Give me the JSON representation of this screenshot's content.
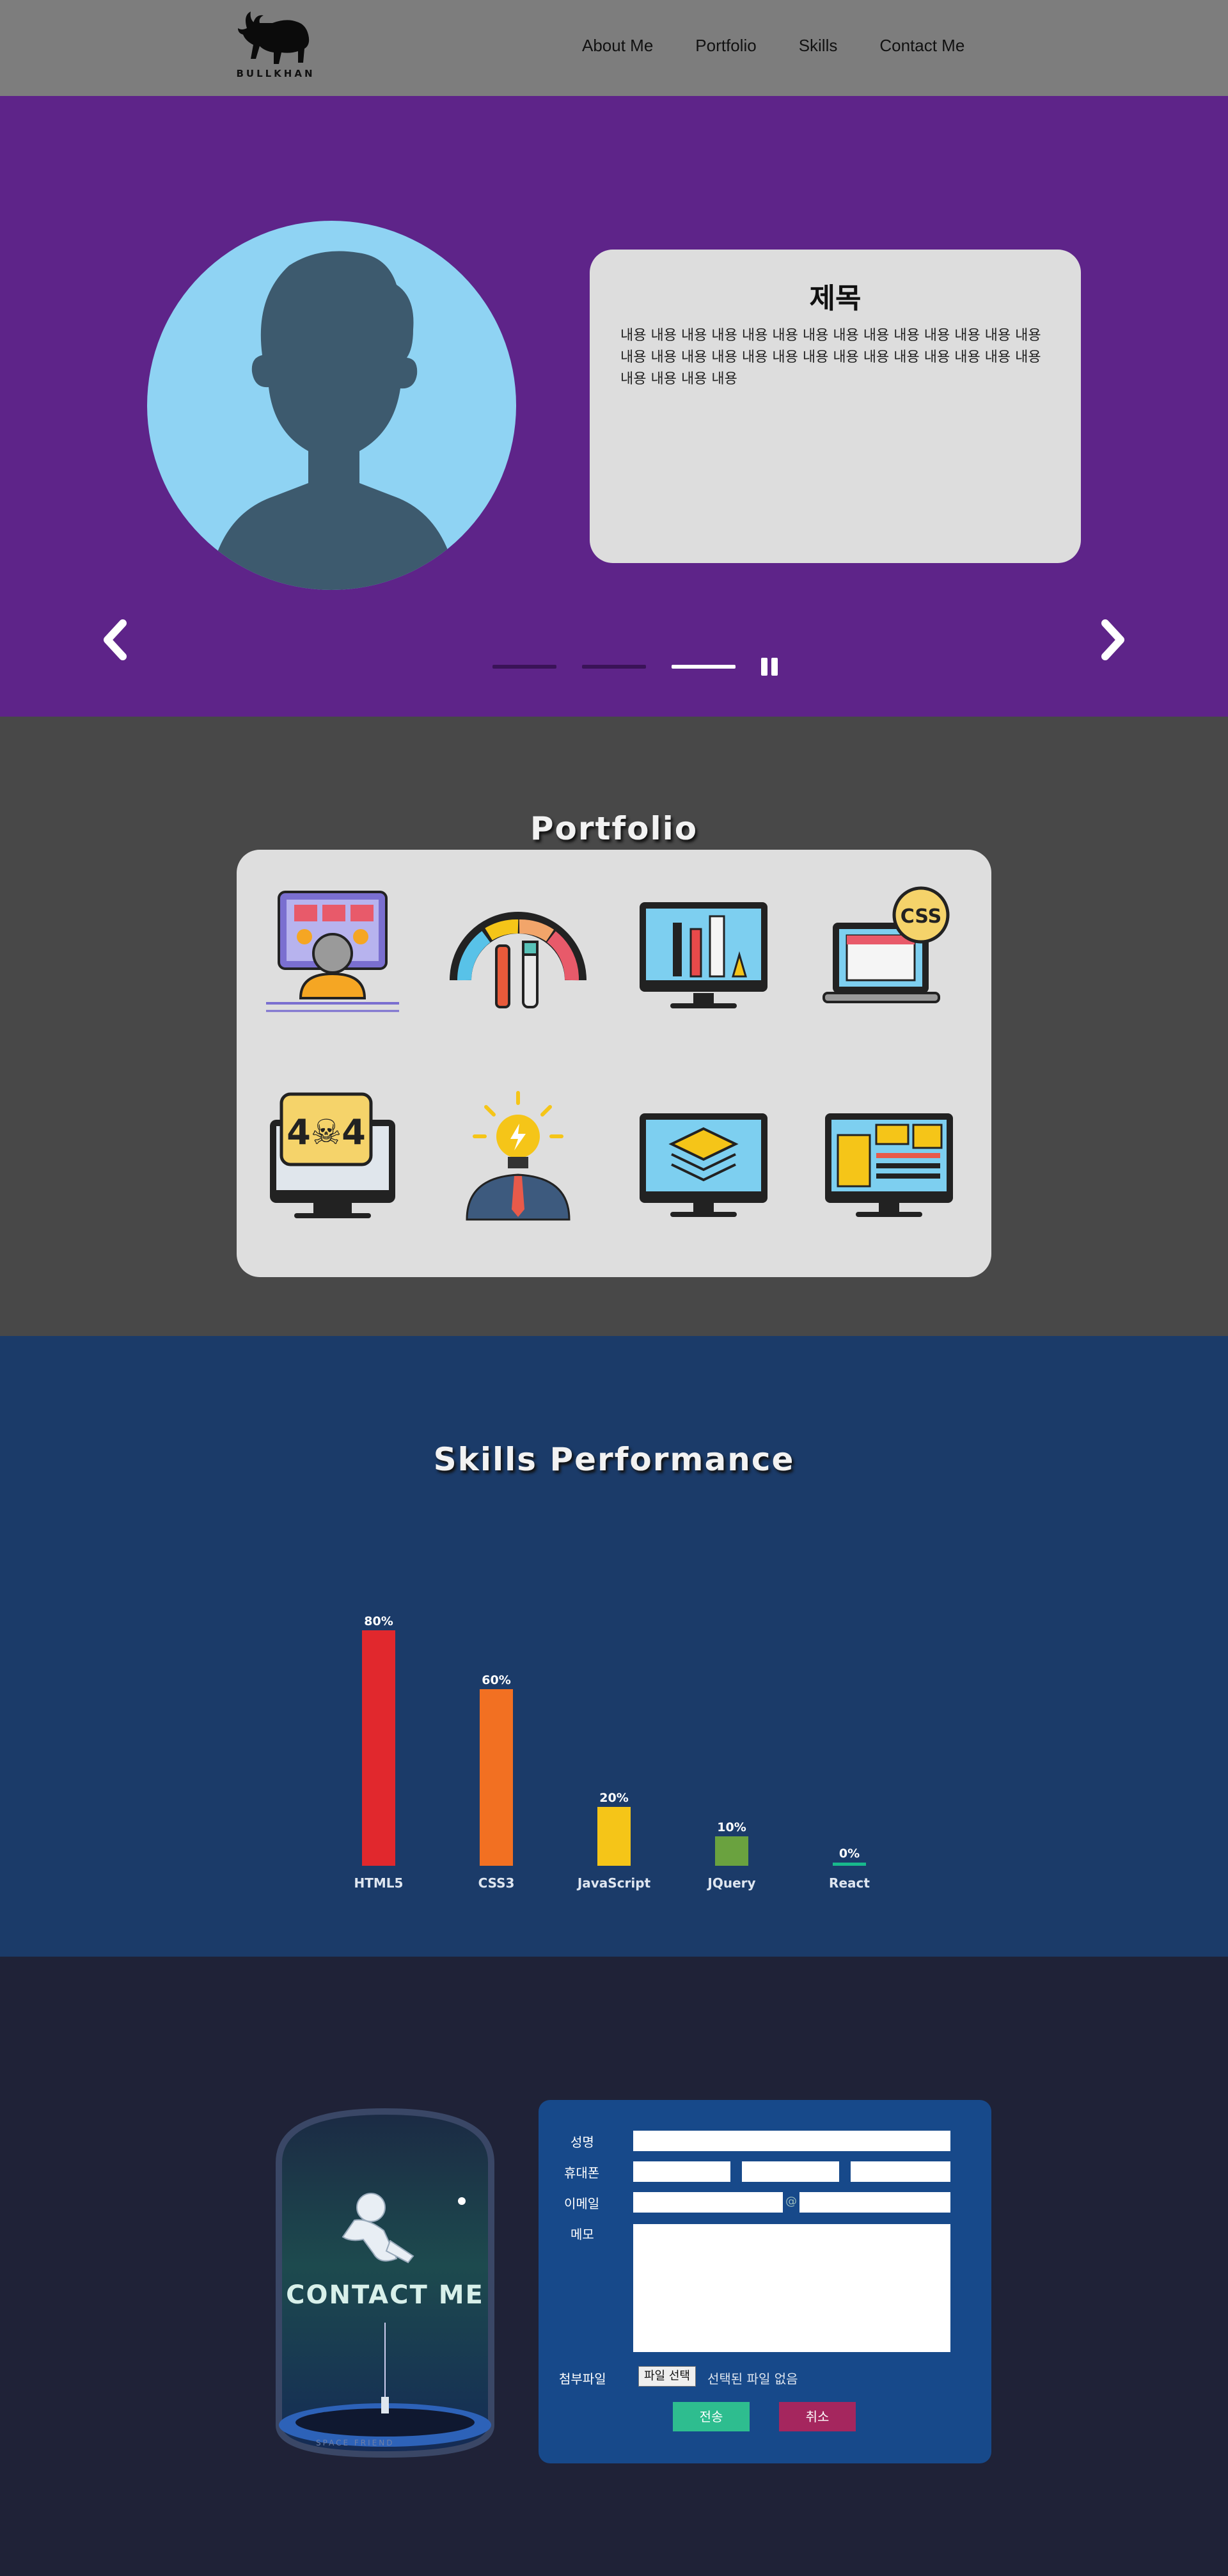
{
  "header": {
    "logo_text": "BULLKHAN",
    "nav": [
      "About Me",
      "Portfolio",
      "Skills",
      "Contact Me"
    ]
  },
  "hero": {
    "card_title": "제목",
    "card_body": "내용 내용 내용 내용 내용 내용 내용 내용 내용 내용 내용 내용 내용 내용 내용 내용 내용 내용 내용 내용 내용 내용 내용 내용 내용 내용 내용 내용 내용 내용 내용 내용",
    "slides_count": 3,
    "active_slide": 3
  },
  "portfolio": {
    "title": "Portfolio",
    "icons": [
      "web-developer-icon",
      "color-palette-icon",
      "design-monitor-icon",
      "css-laptop-icon",
      "error-404-icon",
      "idea-businessman-icon",
      "layers-monitor-icon",
      "web-layout-icon"
    ]
  },
  "skills": {
    "title": "Skills Performance"
  },
  "chart_data": {
    "type": "bar",
    "categories": [
      "HTML5",
      "CSS3",
      "JavaScript",
      "JQuery",
      "React"
    ],
    "values": [
      80,
      60,
      20,
      10,
      0
    ],
    "value_labels": [
      "80%",
      "60%",
      "20%",
      "10%",
      "0%"
    ],
    "colors": [
      "#e1282d",
      "#f27022",
      "#f5c518",
      "#6aa23f",
      "#18b98c"
    ],
    "ylim": [
      0,
      100
    ],
    "title": "",
    "xlabel": "",
    "ylabel": ""
  },
  "contact": {
    "image_caption": "CONTACT ME",
    "image_subcaption": "SPACE FRIEND",
    "labels": {
      "name": "성명",
      "phone": "휴대폰",
      "email": "이메일",
      "memo": "메모",
      "file": "첨부파일"
    },
    "email_at": "@",
    "file_button": "파일 선택",
    "file_status": "선택된 파일 없음",
    "submit": "전송",
    "cancel": "취소",
    "colors": {
      "submit": "#2ebd8f",
      "cancel": "#a5265e"
    }
  }
}
